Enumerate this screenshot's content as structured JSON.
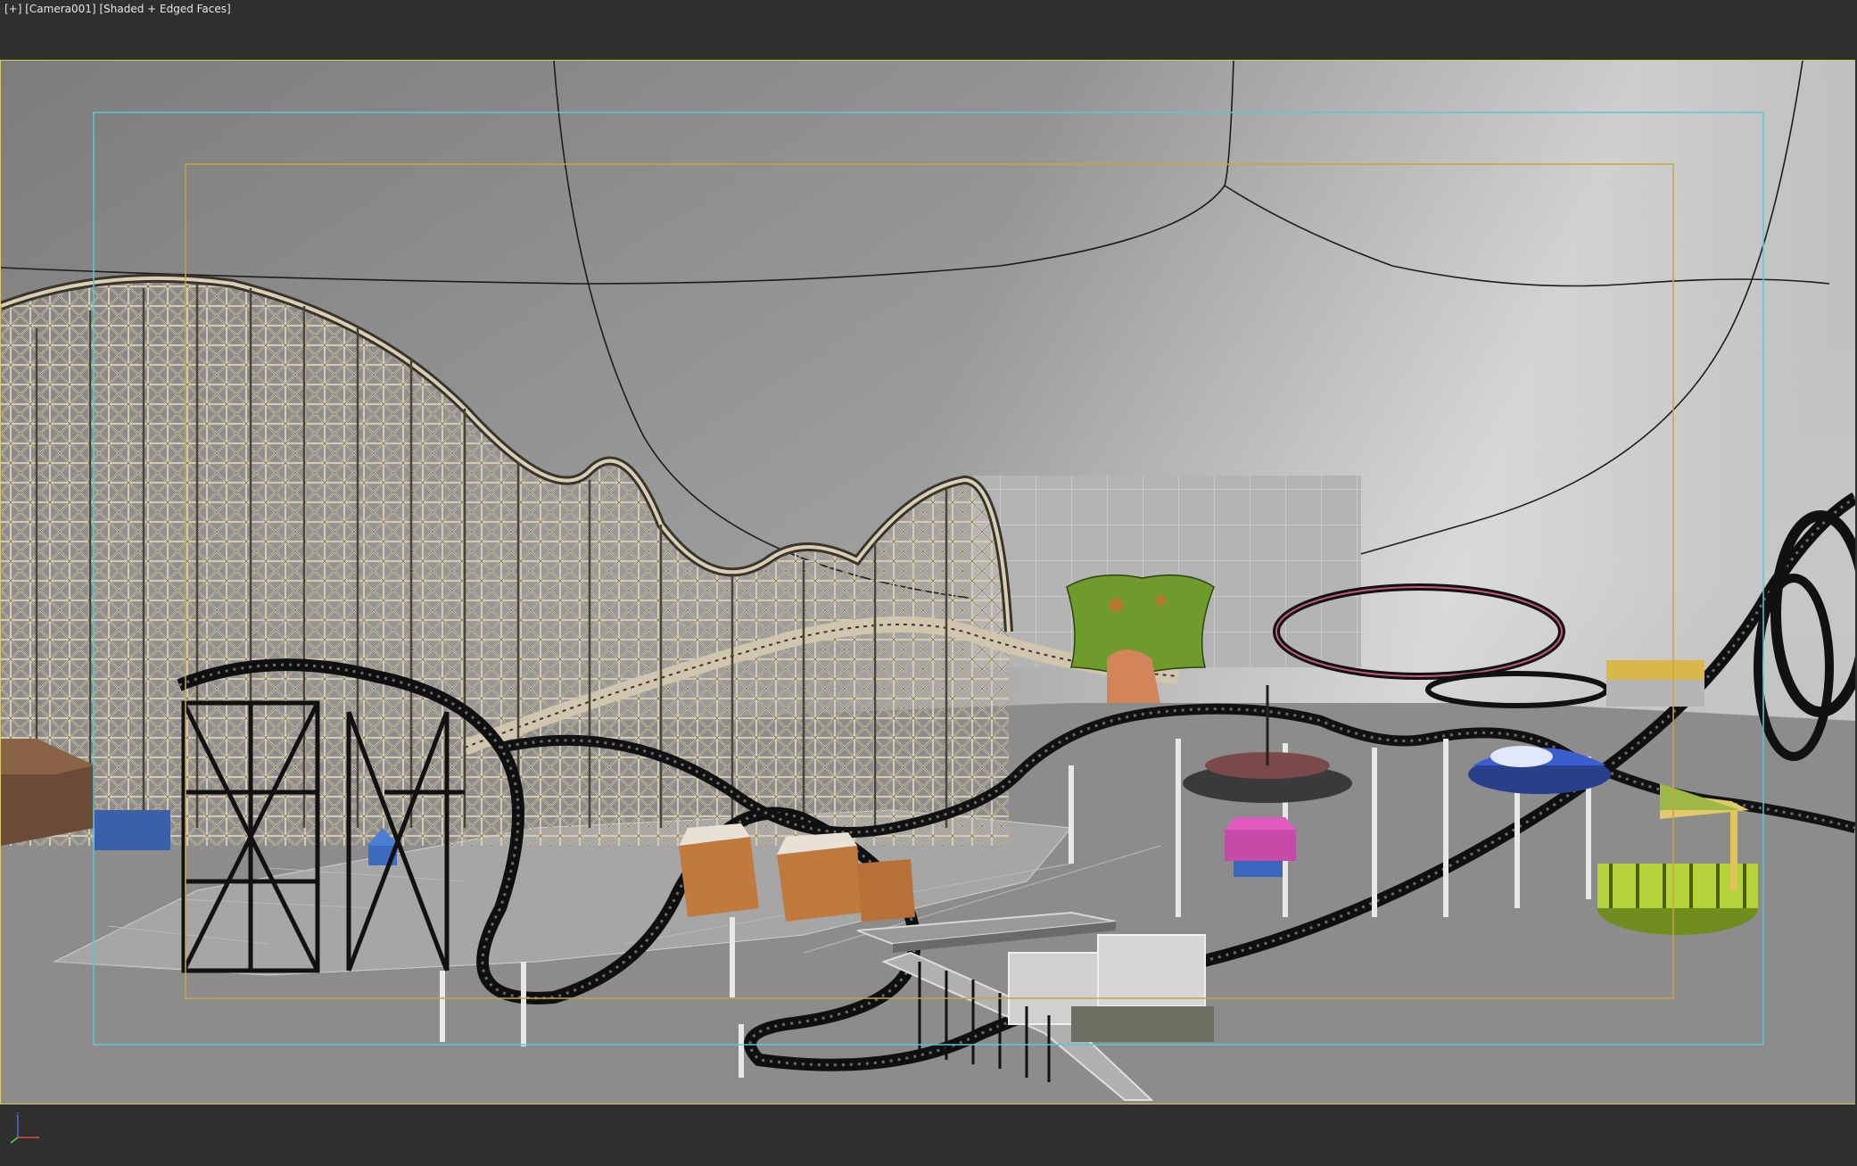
{
  "viewport": {
    "menu_plus": "[+]",
    "camera": "[Camera001]",
    "shading": "[Shaded + Edged Faces]"
  },
  "colors": {
    "background": "#2f2f2f",
    "viewport_border": "#d8c96a",
    "safe_frame_outer": "#5fc7d0",
    "safe_frame_inner": "#c8a24a",
    "sky_top": "#8f8f8f",
    "ground": "#8a8a8a",
    "wood_track": "#c9bfa6",
    "steel_track": "#1a1a1a"
  },
  "scene": {
    "icons": [
      "axis-gizmo-icon"
    ]
  }
}
